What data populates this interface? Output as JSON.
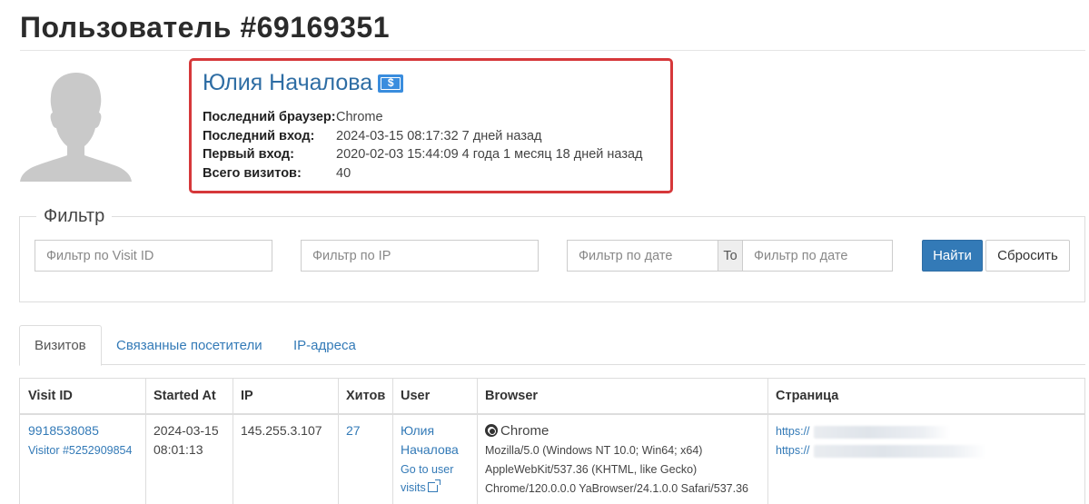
{
  "page": {
    "title": "Пользователь #69169351"
  },
  "profile": {
    "name": "Юлия Началова",
    "badge_icon": "money-icon",
    "accent_color": "#d6383a",
    "rows": [
      {
        "label": "Последний браузер:",
        "value": "Chrome"
      },
      {
        "label": "Последний вход:",
        "value": "2024-03-15 08:17:32 7 дней назад"
      },
      {
        "label": "Первый вход:",
        "value": "2020-02-03 15:44:09 4 года 1 месяц 18 дней назад"
      },
      {
        "label": "Всего визитов:",
        "value": "40"
      }
    ]
  },
  "filter": {
    "legend": "Фильтр",
    "visit_id_placeholder": "Фильтр по Visit ID",
    "ip_placeholder": "Фильтр по IP",
    "date_from_placeholder": "Фильтр по дате",
    "to_label": "To",
    "date_to_placeholder": "Фильтр по дате",
    "find_label": "Найти",
    "reset_label": "Сбросить"
  },
  "tabs": [
    {
      "label": "Визитов",
      "active": true
    },
    {
      "label": "Связанные посетители",
      "active": false
    },
    {
      "label": "IP-адреса",
      "active": false
    }
  ],
  "table": {
    "headers": [
      "Visit ID",
      "Started At",
      "IP",
      "Хитов",
      "User",
      "Browser",
      "Страница"
    ],
    "rows": [
      {
        "visit_id": "9918538085",
        "visitor": "Visitor #5252909854",
        "started_date": "2024-03-15",
        "started_time": "08:01:13",
        "ip": "145.255.3.107",
        "hits": "27",
        "user_first": "Юлия",
        "user_last": "Началова",
        "user_link_1": "Go to user",
        "user_link_2": "visits",
        "browser_name": "Chrome",
        "ua_1": "Mozilla/5.0 (Windows NT 10.0; Win64; x64)",
        "ua_2": "AppleWebKit/537.36 (KHTML, like Gecko)",
        "ua_3": "Chrome/120.0.0.0 YaBrowser/24.1.0.0 Safari/537.36",
        "page_1": "https://",
        "page_2": "https://"
      }
    ]
  }
}
